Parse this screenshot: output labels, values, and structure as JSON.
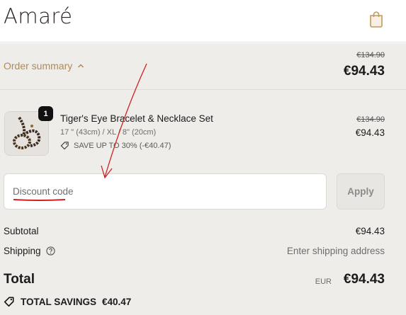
{
  "header": {
    "logo_text": "Amaré",
    "cart_icon": "shopping-bag-icon"
  },
  "summary": {
    "toggle_label": "Order summary",
    "old_price": "€134.90",
    "price": "€94.43"
  },
  "item": {
    "quantity": "1",
    "title": "Tiger's Eye Bracelet & Necklace Set",
    "variant": "17 \" (43cm) / XL / 8\" (20cm)",
    "savings": "SAVE UP TO 30% (-€40.47)",
    "old_price": "€134.90",
    "price": "€94.43"
  },
  "discount": {
    "placeholder": "Discount code",
    "apply_label": "Apply"
  },
  "subtotal": {
    "label": "Subtotal",
    "value": "€94.43"
  },
  "shipping": {
    "label": "Shipping",
    "value": "Enter shipping address"
  },
  "total": {
    "label": "Total",
    "currency": "EUR",
    "value": "€94.43"
  },
  "total_savings": {
    "label": "TOTAL SAVINGS",
    "value": "€40.47"
  },
  "colors": {
    "accent": "#b08a55",
    "annotation": "#cc2222",
    "panel": "#efedea"
  }
}
